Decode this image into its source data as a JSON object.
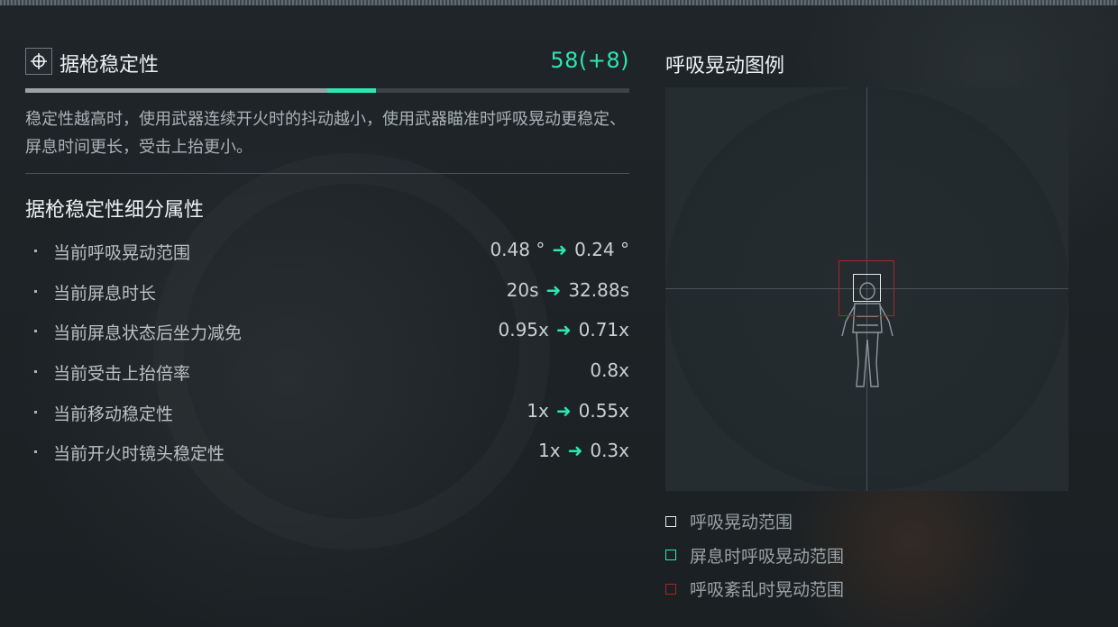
{
  "stat": {
    "title": "据枪稳定性",
    "value": "58(+8)",
    "base_fraction": 0.5,
    "bonus_fraction": 0.08,
    "description": "稳定性越高时，使用武器连续开火时的抖动越小，使用武器瞄准时呼吸晃动更稳定、屏息时间更长，受击上抬更小。",
    "icon": "crosshair-icon"
  },
  "breakdown": {
    "title": "据枪稳定性细分属性",
    "attributes": [
      {
        "name": "当前呼吸晃动范围",
        "from": "0.48 °",
        "to": "0.24 °"
      },
      {
        "name": "当前屏息时长",
        "from": "20s",
        "to": "32.88s"
      },
      {
        "name": "当前屏息状态后坐力减免",
        "from": "0.95x",
        "to": "0.71x"
      },
      {
        "name": "当前受击上抬倍率",
        "from": "",
        "to": "0.8x"
      },
      {
        "name": "当前移动稳定性",
        "from": "1x",
        "to": "0.55x"
      },
      {
        "name": "当前开火时镜头稳定性",
        "from": "1x",
        "to": "0.3x"
      }
    ]
  },
  "legend": {
    "title": "呼吸晃动图例",
    "items": [
      {
        "label": "呼吸晃动范围",
        "color": "#e7ecee"
      },
      {
        "label": "屏息时呼吸晃动范围",
        "color": "#2de6b0"
      },
      {
        "label": "呼吸紊乱时晃动范围",
        "color": "#a8262a"
      }
    ]
  },
  "colors": {
    "accent": "#2de6b0",
    "danger": "#a8262a",
    "text": "#eef1f2"
  }
}
